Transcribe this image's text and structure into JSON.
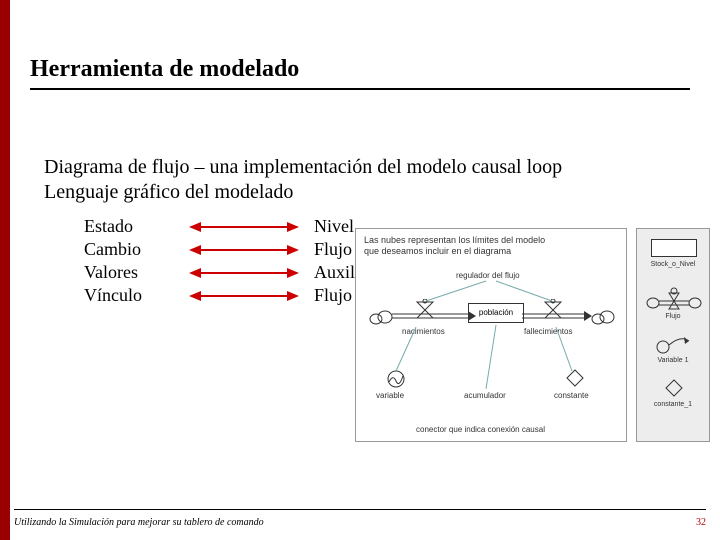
{
  "title": "Herramienta de modelado",
  "body": {
    "line1": "Diagrama de flujo – una implementación del modelo causal loop",
    "line2": "Lenguaje gráfico del modelado"
  },
  "map": {
    "rows": [
      {
        "left": "Estado",
        "right": "Nivel"
      },
      {
        "left": "Cambio",
        "right": "Flujo"
      },
      {
        "left": "Valores",
        "right": "Auxiliar"
      },
      {
        "left": "Vínculo",
        "right": "Flujo de Información"
      }
    ]
  },
  "diagram1": {
    "caption_line1": "Las nubes representan los límites del modelo",
    "caption_line2": "que deseamos incluir en el diagrama",
    "labels": {
      "regulador": "regulador del flujo",
      "poblacion": "población",
      "nacimientos": "nacimientos",
      "fallecimientos": "fallecimientos",
      "variable": "variable",
      "acumulador": "acumulador",
      "constante": "constante",
      "conector": "conector que indica conexión causal"
    }
  },
  "diagram2": {
    "stock": "Stock_o_Nivel",
    "flujo": "Flujo",
    "variable": "Variable 1",
    "constante": "constante_1"
  },
  "footer": "Utilizando la Simulación para mejorar su tablero de comando",
  "page": "32",
  "colors": {
    "accent": "#990000"
  }
}
